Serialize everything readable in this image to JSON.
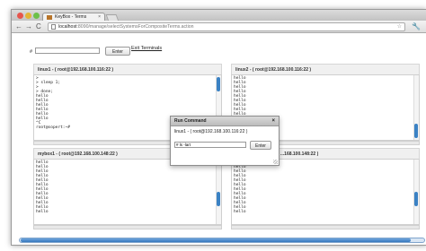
{
  "browser": {
    "tab_title": "KeyBox - Terms",
    "tab_close": "×",
    "nav_back": "←",
    "nav_forward": "→",
    "nav_reload": "C",
    "url_host": "localhost",
    "url_path": ":8090/manage/selectSystemsForCompositeTerms.action",
    "star": "☆",
    "wrench": "🔧"
  },
  "command_bar": {
    "prompt": "#",
    "input_value": "",
    "enter_label": "Enter",
    "exit_label": "Exit Terminals"
  },
  "terminals": [
    {
      "header": "linux1 - ( root@192.168.100.116:22 )",
      "lines": [
        ">",
        "> sleep 1;",
        ">",
        "> done;",
        "hello",
        "hello",
        "hello",
        "hello",
        "hello",
        "hello",
        "^C",
        "root@sopert:~#"
      ]
    },
    {
      "header": "linux2 - ( root@192.168.100.116:22 )",
      "lines": [
        "hello",
        "hello",
        "hello",
        "hello",
        "hello",
        "hello",
        "hello",
        "hello",
        "hello",
        "hello",
        "hello",
        "hello",
        "hello"
      ]
    },
    {
      "header": "mybox1 - ( root@192.168.100.148:22 )",
      "lines": [
        "hello",
        "hello",
        "hello",
        "hello",
        "hello",
        "hello",
        "hello",
        "hello",
        "hello",
        "hello",
        "hello",
        "hello"
      ]
    },
    {
      "header": "...168.100.148:22 )",
      "lines": [
        "hello",
        "hello",
        "hello",
        "hello",
        "hello",
        "hello",
        "hello",
        "hello",
        "hello",
        "hello",
        "hello",
        "hello"
      ]
    }
  ],
  "run_command_dialog": {
    "title": "Run Command",
    "close": "×",
    "host": "linux1 - ( root@192.168.100.116:22 )",
    "input_value": "# ls -lart",
    "enter_label": "Enter"
  }
}
